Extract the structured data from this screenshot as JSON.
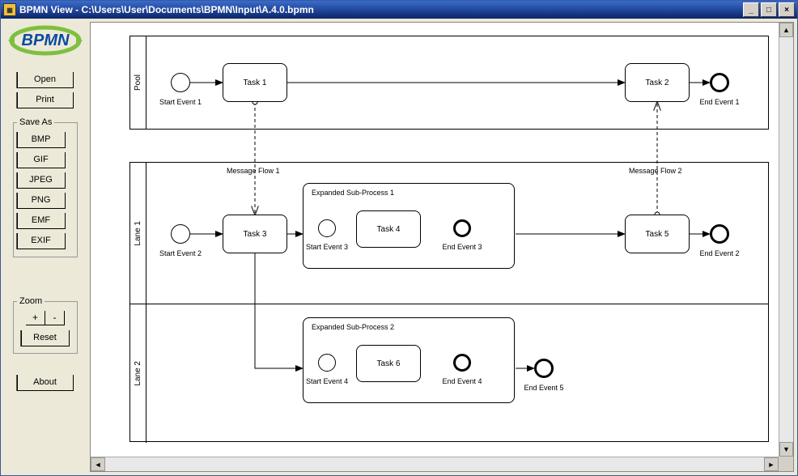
{
  "window": {
    "title": "BPMN View - C:\\Users\\User\\Documents\\BPMN\\Input\\A.4.0.bpmn",
    "controls": {
      "minimize": "_",
      "maximize": "□",
      "close": "×"
    }
  },
  "logo_text": "BPMN",
  "buttons": {
    "open": "Open",
    "print": "Print",
    "bmp": "BMP",
    "gif": "GIF",
    "jpeg": "JPEG",
    "png": "PNG",
    "emf": "EMF",
    "exif": "EXIF",
    "zoom_in": "+",
    "zoom_out": "-",
    "reset": "Reset",
    "about": "About"
  },
  "groups": {
    "save_as": "Save As",
    "zoom": "Zoom"
  },
  "pools": {
    "pool": "Pool",
    "lane1": "Lane 1",
    "lane2": "Lane 2"
  },
  "tasks": {
    "task1": "Task 1",
    "task2": "Task 2",
    "task3": "Task 3",
    "task4": "Task 4",
    "task5": "Task 5",
    "task6": "Task 6"
  },
  "subprocs": {
    "sp1": "Expanded Sub-Process 1",
    "sp2": "Expanded Sub-Process 2"
  },
  "events": {
    "start1": "Start Event 1",
    "end1": "End Event 1",
    "start2": "Start Event 2",
    "end2": "End Event 2",
    "start3": "Start Event 3",
    "end3": "End Event 3",
    "start4": "Start Event 4",
    "end4": "End Event 4",
    "end5": "End Event 5"
  },
  "messages": {
    "mf1": "Message Flow 1",
    "mf2": "Message Flow 2"
  }
}
